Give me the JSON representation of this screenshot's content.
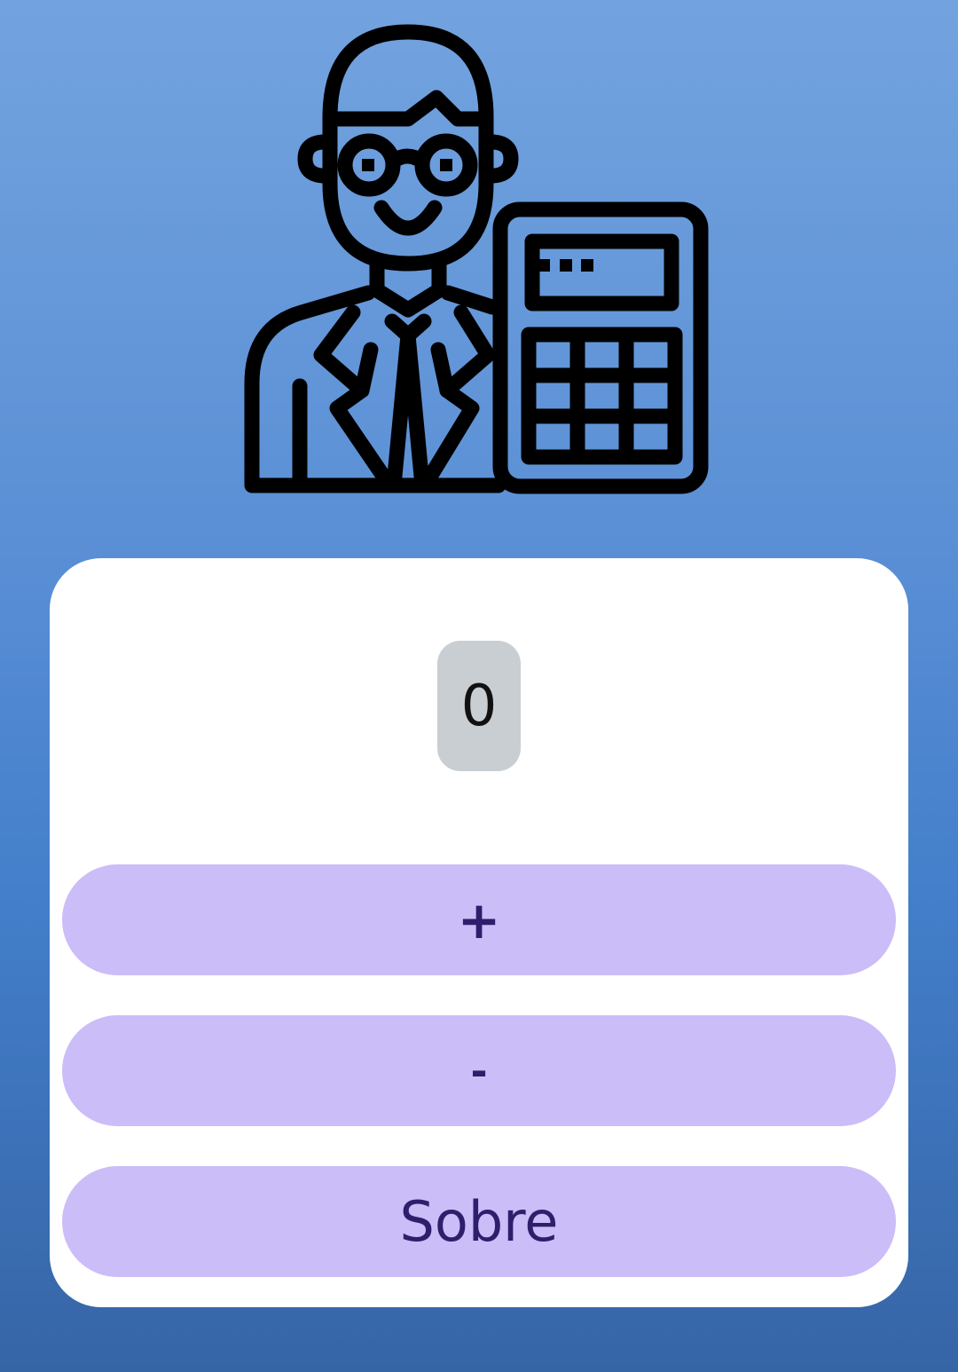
{
  "app": {
    "illustration_icon": "accountant-with-calculator-icon",
    "background_gradient": [
      "#73a3df",
      "#3665a6"
    ]
  },
  "counter": {
    "value": "0"
  },
  "buttons": {
    "increment_label": "+",
    "decrement_label": "-",
    "about_label": "Sobre"
  },
  "colors": {
    "card": "#ffffff",
    "counter_bg": "#c9ced2",
    "button_bg": "#cbbdf8",
    "button_text": "#2d1f6b"
  }
}
